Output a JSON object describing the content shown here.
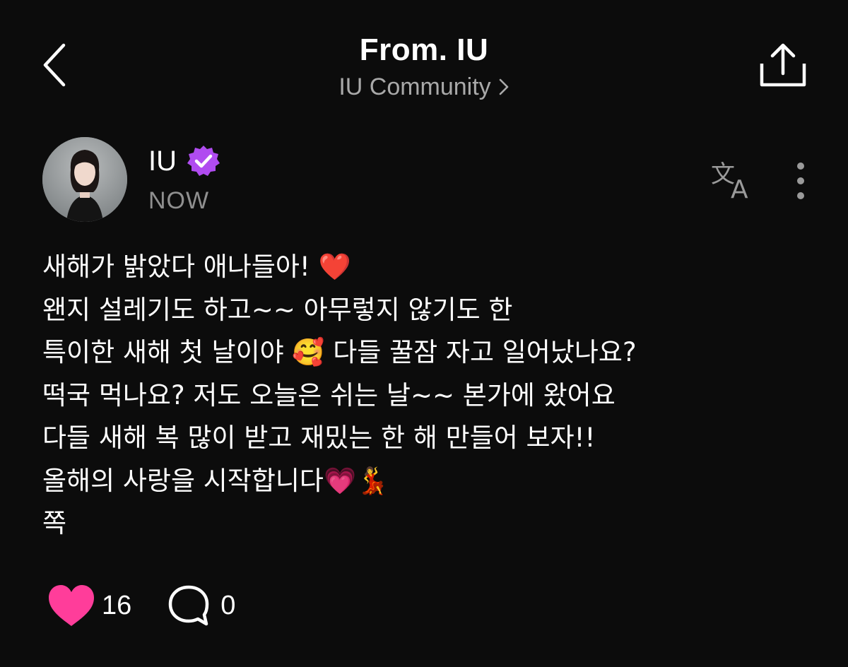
{
  "header": {
    "title": "From. IU",
    "subtitle": "IU Community",
    "back_icon": "chevron-left-icon",
    "share_icon": "share-icon"
  },
  "post": {
    "author": "IU",
    "verified": true,
    "time": "NOW",
    "lines": [
      "새해가 밝았다 애나들아!  ❤️",
      "왠지 설레기도 하고~~ 아무렇지 않기도 한",
      "특이한 새해 첫 날이야 🥰 다들 꿀잠 자고 일어났나요?",
      "떡국 먹나요? 저도 오늘은 쉬는 날~~ 본가에 왔어요",
      "다들 새해 복 많이 받고 재밌는 한 해 만들어 보자!!",
      "올해의 사랑을 시작합니다💗💃",
      "쪽"
    ]
  },
  "actions": {
    "likes": "16",
    "comments": "0"
  },
  "colors": {
    "background": "#0c0c0c",
    "like": "#ff3d9a",
    "verified_badge": "#b04cf0",
    "muted_text": "#a9a9a9"
  }
}
